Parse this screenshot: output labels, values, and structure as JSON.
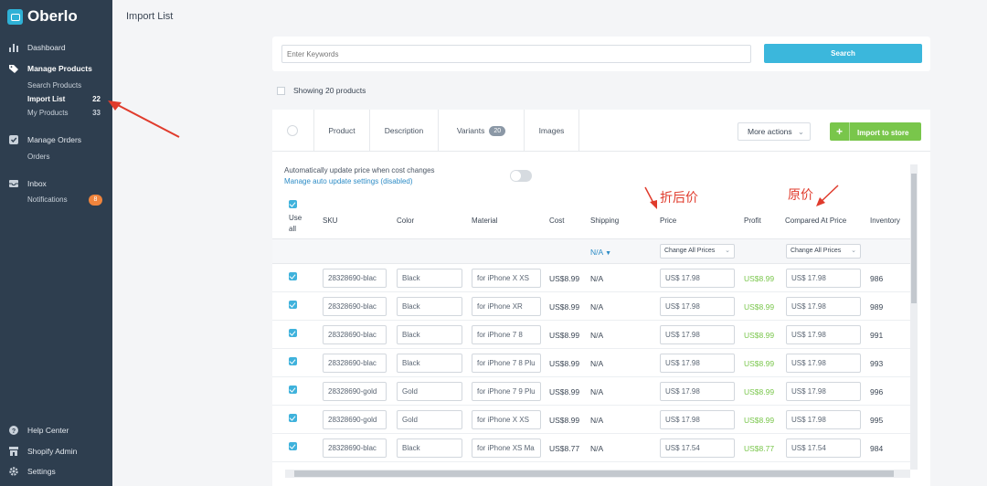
{
  "app": {
    "name": "Oberlo"
  },
  "sidebar": {
    "items": [
      {
        "label": "Dashboard",
        "icon": "bar-chart-icon"
      },
      {
        "label": "Manage Products",
        "icon": "tag-icon",
        "subitems": [
          {
            "label": "Search Products",
            "count": ""
          },
          {
            "label": "Import List",
            "count": "22"
          },
          {
            "label": "My Products",
            "count": "33"
          }
        ]
      },
      {
        "label": "Manage Orders",
        "icon": "check-square-icon",
        "subitems": [
          {
            "label": "Orders",
            "count": ""
          }
        ]
      },
      {
        "label": "Inbox",
        "icon": "inbox-icon",
        "subitems": [
          {
            "label": "Notifications",
            "count": "8"
          }
        ]
      }
    ],
    "bottom": [
      {
        "label": "Help Center",
        "icon": "help-icon"
      },
      {
        "label": "Shopify Admin",
        "icon": "shop-icon"
      },
      {
        "label": "Settings",
        "icon": "gear-icon"
      }
    ]
  },
  "page": {
    "title": "Import List"
  },
  "search": {
    "placeholder": "Enter Keywords",
    "button": "Search"
  },
  "showing": "Showing 20 products",
  "tabs": [
    {
      "label": "Product"
    },
    {
      "label": "Description"
    },
    {
      "label": "Variants",
      "badge": "20"
    },
    {
      "label": "Images"
    }
  ],
  "actions": {
    "more": "More actions",
    "import": "Import to store"
  },
  "auto_update": {
    "label": "Automatically update price when cost changes",
    "link": "Manage auto update settings (disabled)"
  },
  "table": {
    "headers": {
      "use_all_1": "Use",
      "use_all_2": "all",
      "sku": "SKU",
      "color": "Color",
      "material": "Material",
      "cost": "Cost",
      "shipping": "Shipping",
      "price": "Price",
      "profit": "Profit",
      "compared": "Compared At Price",
      "inventory": "Inventory"
    },
    "shipping_select": "N/A",
    "change_all_prices": "Change All Prices",
    "rows": [
      {
        "sku": "28328690-blac",
        "color": "Black",
        "material": "for iPhone X XS",
        "cost": "US$8.99",
        "shipping": "N/A",
        "price": "US$ 17.98",
        "profit": "US$8.99",
        "compared": "US$ 17.98",
        "inventory": "986"
      },
      {
        "sku": "28328690-blac",
        "color": "Black",
        "material": "for iPhone XR",
        "cost": "US$8.99",
        "shipping": "N/A",
        "price": "US$ 17.98",
        "profit": "US$8.99",
        "compared": "US$ 17.98",
        "inventory": "989"
      },
      {
        "sku": "28328690-blac",
        "color": "Black",
        "material": "for iPhone 7 8",
        "cost": "US$8.99",
        "shipping": "N/A",
        "price": "US$ 17.98",
        "profit": "US$8.99",
        "compared": "US$ 17.98",
        "inventory": "991"
      },
      {
        "sku": "28328690-blac",
        "color": "Black",
        "material": "for iPhone 7 8 Plu",
        "cost": "US$8.99",
        "shipping": "N/A",
        "price": "US$ 17.98",
        "profit": "US$8.99",
        "compared": "US$ 17.98",
        "inventory": "993"
      },
      {
        "sku": "28328690-gold",
        "color": "Gold",
        "material": "for iPhone 7 9 Plu",
        "cost": "US$8.99",
        "shipping": "N/A",
        "price": "US$ 17.98",
        "profit": "US$8.99",
        "compared": "US$ 17.98",
        "inventory": "996"
      },
      {
        "sku": "28328690-gold",
        "color": "Gold",
        "material": "for iPhone X XS",
        "cost": "US$8.99",
        "shipping": "N/A",
        "price": "US$ 17.98",
        "profit": "US$8.99",
        "compared": "US$ 17.98",
        "inventory": "995"
      },
      {
        "sku": "28328690-blac",
        "color": "Black",
        "material": "for iPhone XS Ma",
        "cost": "US$8.77",
        "shipping": "N/A",
        "price": "US$ 17.54",
        "profit": "US$8.77",
        "compared": "US$ 17.54",
        "inventory": "984"
      }
    ]
  },
  "annotations": {
    "price_note": "折后价",
    "compared_note": "原价"
  },
  "colors": {
    "sidebar": "#2e3e4f",
    "accent": "#3bb7dc",
    "green": "#79c64b",
    "annotation": "#e03b2c",
    "badge": "#f0843c"
  }
}
